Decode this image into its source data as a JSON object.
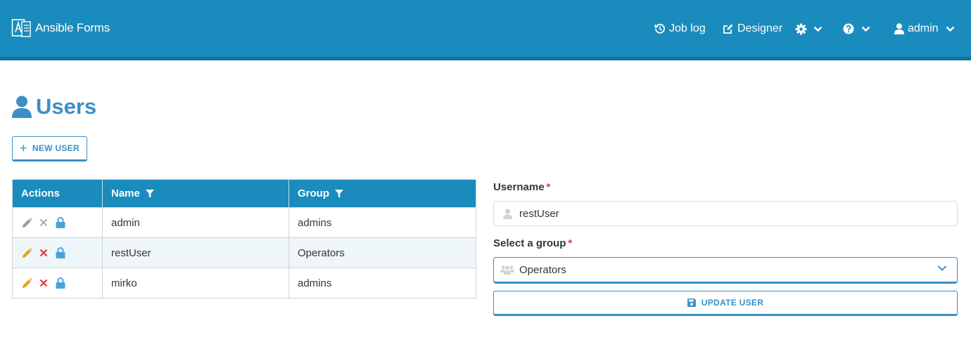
{
  "navbar": {
    "brand": "Ansible Forms",
    "job_log": "Job log",
    "designer": "Designer",
    "user": "admin"
  },
  "page": {
    "title": "Users",
    "new_user_label": "NEW USER"
  },
  "table": {
    "headers": {
      "actions": "Actions",
      "name": "Name",
      "group": "Group"
    },
    "rows": [
      {
        "name": "admin",
        "group": "admins",
        "editable": false
      },
      {
        "name": "restUser",
        "group": "Operators",
        "editable": true
      },
      {
        "name": "mirko",
        "group": "admins",
        "editable": true
      }
    ]
  },
  "form": {
    "username_label": "Username",
    "username_value": "restUser",
    "group_label": "Select a group",
    "group_value": "Operators",
    "required_mark": "*",
    "update_label": "UPDATE USER"
  },
  "colors": {
    "navbar": "#1a8bbd",
    "accent": "#3a8fc7",
    "edit": "#e8a21b",
    "delete": "#e03b3b",
    "lock": "#4aa3d8",
    "disabled": "#9e9e9e"
  }
}
